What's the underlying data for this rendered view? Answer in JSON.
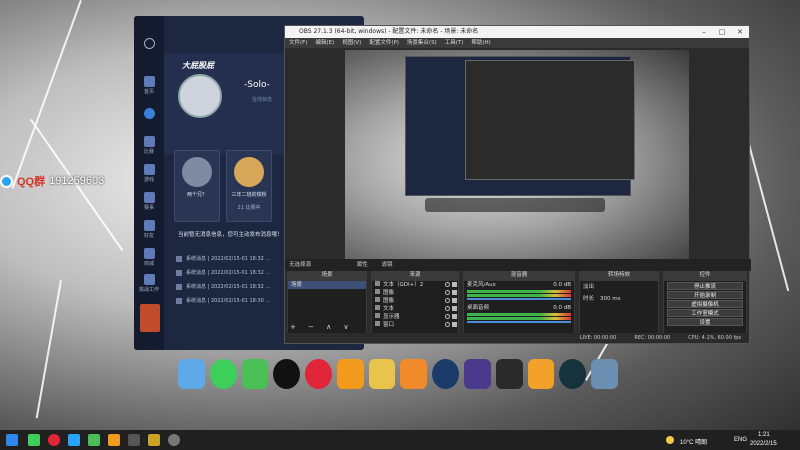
{
  "desktop": {
    "qq_label": "QQ群",
    "qq_number": "191259603"
  },
  "game_client": {
    "logo": "大屁股屁",
    "username": "-Solo-",
    "status_text": "在线状态",
    "rail_items": [
      "首页",
      "",
      "比赛",
      "游戏",
      "赛事",
      "好友",
      "",
      "商城",
      "",
      "挑战工作"
    ],
    "friends": [
      {
        "name": "两个兄？"
      },
      {
        "name": "三年二班的铁粉"
      },
      {
        "name": ""
      }
    ],
    "friend_status": [
      "",
      "",
      "21 比赛中"
    ],
    "notice": "当前暂无消息信息，您可主动发布消息哦！",
    "notice_tail": "哦！",
    "messages": [
      "系统消息 | 2022/02/15-01 18:32 ...",
      "系统消息 | 2022/02/15-01 18:32 ...",
      "系统消息 | 2022/02/15-01 18:32 ...",
      "系统消息 | 2022/02/15-01 18:30 ..."
    ]
  },
  "obs": {
    "title": "OBS 27.1.3 (64-bit, windows) - 配置文件: 未命名 - 场景: 未命名",
    "menu": [
      "文件(F)",
      "编辑(E)",
      "视图(V)",
      "配置文件(P)",
      "场景集合(S)",
      "工具(T)",
      "帮助(H)"
    ],
    "scene_bar": "无选择源",
    "scene_tabs": [
      "属性",
      "滤镜"
    ],
    "dock_titles": [
      "场景",
      "来源",
      "混音器",
      "转场特效",
      "控件"
    ],
    "scenes": [
      "场景"
    ],
    "sources": [
      "文本（GDI+）2",
      "图像",
      "图像",
      "文本",
      "显示器",
      "窗口"
    ],
    "mixer": [
      {
        "name": "麦克风/Aux",
        "level": "0.0 dB"
      },
      {
        "name": "桌面音频",
        "level": "0.0 dB"
      }
    ],
    "transition": {
      "type": "淡出",
      "duration_label": "时长",
      "duration_value": "300 ms"
    },
    "controls": [
      "停止推流",
      "开始录制",
      "虚拟摄像机",
      "工作室模式",
      "设置",
      "退出"
    ],
    "status": [
      "LIVE: 00:00:00",
      "REC: 00:00:00",
      "CPU: 4.1%, 60.00 fps"
    ]
  },
  "taskbar": {
    "weather": "10°C 晴朗",
    "lang": "ENG",
    "time": "1:21",
    "date": "2022/2/15"
  }
}
